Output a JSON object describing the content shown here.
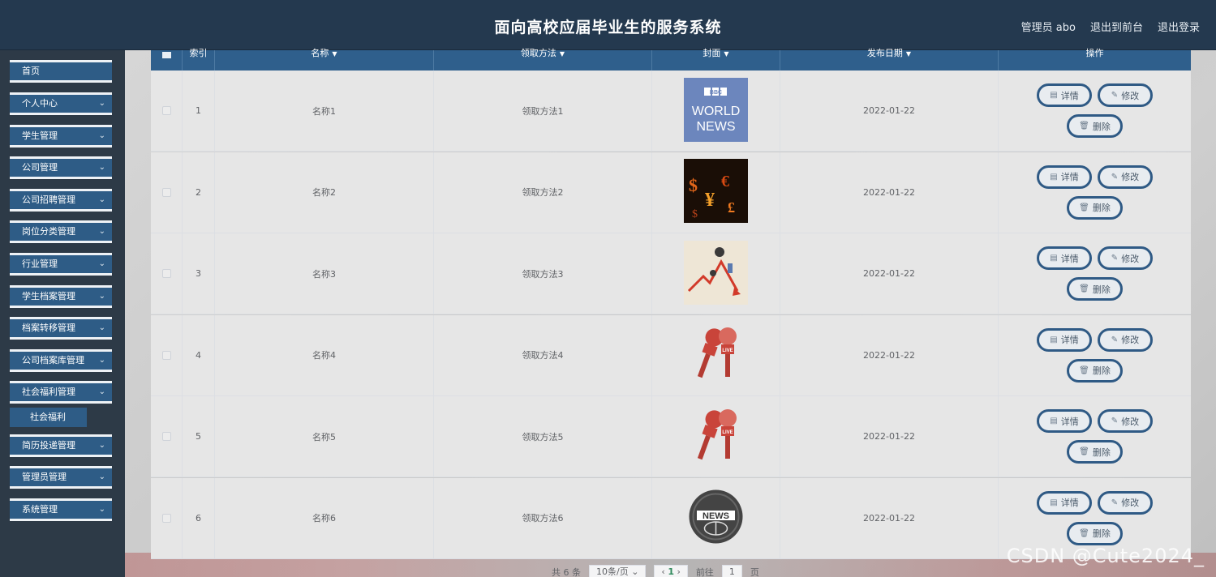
{
  "header": {
    "title": "面向高校应届毕业生的服务系统",
    "admin_label": "管理员 abo",
    "front_label": "退出到前台",
    "logout_label": "退出登录"
  },
  "sidebar": {
    "items": [
      {
        "label": "首页",
        "chevron": false
      },
      {
        "label": "个人中心",
        "chevron": true
      },
      {
        "label": "学生管理",
        "chevron": true
      },
      {
        "label": "公司管理",
        "chevron": true
      },
      {
        "label": "公司招聘管理",
        "chevron": true
      },
      {
        "label": "岗位分类管理",
        "chevron": true
      },
      {
        "label": "行业管理",
        "chevron": true
      },
      {
        "label": "学生档案管理",
        "chevron": true
      },
      {
        "label": "档案转移管理",
        "chevron": true
      },
      {
        "label": "公司档案库管理",
        "chevron": true
      },
      {
        "label": "社会福利管理",
        "chevron": true
      },
      {
        "label": "简历投递管理",
        "chevron": true
      },
      {
        "label": "管理员管理",
        "chevron": true
      },
      {
        "label": "系统管理",
        "chevron": true
      }
    ],
    "sub_item": "社会福利"
  },
  "table": {
    "columns": [
      "索引",
      "名称",
      "领取方法",
      "封面",
      "发布日期",
      "操作"
    ],
    "sort_glyph": "▼",
    "rows": [
      {
        "index": "1",
        "name": "名称1",
        "method": "领取方法1",
        "cover": "bbc-world-news",
        "date": "2022-01-22"
      },
      {
        "index": "2",
        "name": "名称2",
        "method": "领取方法2",
        "cover": "money-symbols",
        "date": "2022-01-22"
      },
      {
        "index": "3",
        "name": "名称3",
        "method": "领取方法3",
        "cover": "falling-chart",
        "date": "2022-01-22"
      },
      {
        "index": "4",
        "name": "名称4",
        "method": "领取方法4",
        "cover": "news-microphones",
        "date": "2022-01-22"
      },
      {
        "index": "5",
        "name": "名称5",
        "method": "领取方法5",
        "cover": "news-microphones",
        "date": "2022-01-22"
      },
      {
        "index": "6",
        "name": "名称6",
        "method": "领取方法6",
        "cover": "news-globe",
        "date": "2022-01-22"
      }
    ],
    "actions": {
      "detail": "详情",
      "edit": "修改",
      "delete": "删除"
    }
  },
  "pager": {
    "total": "共 6 条",
    "page_size": "10条/页",
    "current": "1",
    "goto_label": "前往",
    "goto_value": "1",
    "page_unit": "页"
  },
  "watermark": "CSDN @Cute2024_",
  "cover_texts": {
    "bbc": "BBC",
    "world": "WORLD",
    "news": "NEWS",
    "live": "LIVE"
  }
}
